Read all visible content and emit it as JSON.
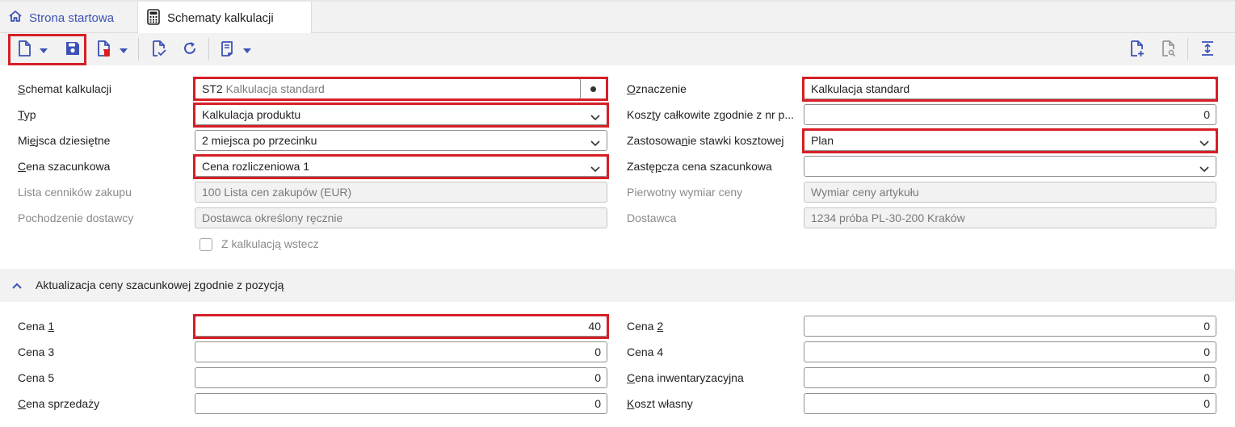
{
  "tabs": {
    "home_label": "Strona startowa",
    "active_label": "Schematy kalkulacji"
  },
  "icons": {
    "home": "home-icon",
    "calculator": "calculator-icon",
    "new": "new-document-icon",
    "save": "save-icon",
    "delete": "delete-document-icon",
    "validate": "validate-document-icon",
    "refresh": "refresh-icon",
    "print": "print-icon",
    "add": "add-document-icon",
    "search": "search-document-icon",
    "expand": "expand-vertical-icon"
  },
  "colors": {
    "accent": "#3b52b4",
    "highlight": "#d61f26"
  },
  "form": {
    "schemat": {
      "label_u": "S",
      "label_rest": "chemat kalkulacji",
      "code": "ST2",
      "desc": "Kalkulacja standard"
    },
    "typ": {
      "label_u": "T",
      "label_rest": "yp",
      "value": "Kalkulacja produktu"
    },
    "miejsca": {
      "label_pre": "Mi",
      "label_u": "e",
      "label_rest": "jsca dziesiętne",
      "value": "2 miejsca po przecinku"
    },
    "cena_szac": {
      "label_u": "C",
      "label_rest": "ena szacunkowa",
      "value": "Cena rozliczeniowa 1"
    },
    "lista": {
      "label": "Lista cenników zakupu",
      "value": "100 Lista cen zakupów (EUR)"
    },
    "pochodzenie": {
      "label": "Pochodzenie dostawcy",
      "value": "Dostawca określony ręcznie"
    },
    "checkbox_label": "Z kalkulacją wstecz",
    "oznaczenie": {
      "label_u": "O",
      "label_rest": "znaczenie",
      "value": "Kalkulacja standard"
    },
    "koszty": {
      "label_pre": "Kosz",
      "label_u": "t",
      "label_rest": "y całkowite zgodnie z nr p...",
      "value": "0"
    },
    "zastosowanie": {
      "label_pre": "Zastosowa",
      "label_u": "n",
      "label_rest": "ie stawki kosztowej",
      "value": "Plan"
    },
    "zastepcza": {
      "label_pre": "Zastę",
      "label_u": "p",
      "label_rest": "cza cena szacunkowa",
      "value": ""
    },
    "pierwotny": {
      "label": "Pierwotny wymiar ceny",
      "value": "Wymiar ceny artykułu"
    },
    "dostawca": {
      "label": "Dostawca",
      "value": "1234 próba PL-30-200 Kraków"
    }
  },
  "section": {
    "title": "Aktualizacja ceny szacunkowej zgodnie z pozycją",
    "cena1": {
      "label_pre": "Cena ",
      "label_u": "1",
      "value": "40"
    },
    "cena2": {
      "label_pre": "Cena ",
      "label_u": "2",
      "value": "0"
    },
    "cena3": {
      "label": "Cena 3",
      "value": "0"
    },
    "cena4": {
      "label": "Cena 4",
      "value": "0"
    },
    "cena5": {
      "label": "Cena 5",
      "value": "0"
    },
    "inwent": {
      "label_u": "C",
      "label_rest": "ena inwentaryzacyjna",
      "value": "0"
    },
    "sprzedazy": {
      "label_u": "C",
      "label_rest": "ena sprzedaży",
      "value": "0"
    },
    "koszt": {
      "label_u": "K",
      "label_rest": "oszt własny",
      "value": "0"
    }
  }
}
